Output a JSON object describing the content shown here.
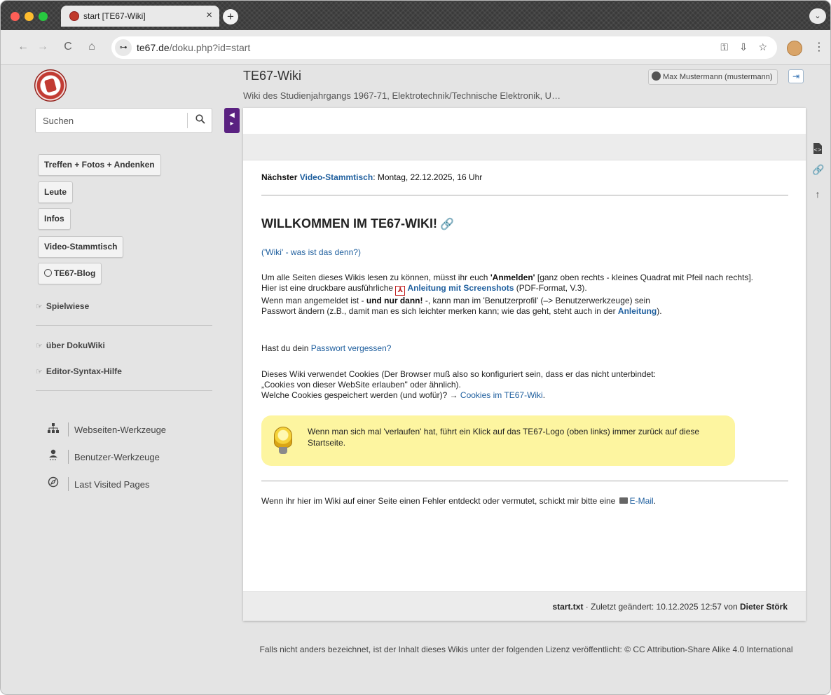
{
  "browser": {
    "tab_title": "start [TE67-Wiki]",
    "tab_close": "×",
    "new_tab": "+",
    "tab_menu": "⌄",
    "back": "←",
    "forward": "→",
    "reload": "C",
    "home": "⌂",
    "site_info": "⊶",
    "url_host": "te67.de",
    "url_path": "/doku.php?id=start",
    "key_icon": "⚿",
    "install_icon": "⇩",
    "star_icon": "☆",
    "menu": "⋮"
  },
  "header": {
    "site_title": "TE67-Wiki",
    "tagline": "Wiki des Studienjahrgangs 1967-71, Elektrotechnik/Technische Elektronik, U…",
    "user": "Max Mustermann (mustermann)",
    "logout_icon": "⇥"
  },
  "sidebar": {
    "search_placeholder": "Suchen",
    "search_icon": "🔍",
    "toggle_icon": "⇦",
    "nav_buttons": [
      "Treffen + Fotos + Andenken",
      "Leute",
      "Infos",
      "Video-Stammtisch",
      "TE67-Blog"
    ],
    "links": [
      "Spielwiese",
      "über DokuWiki",
      "Editor-Syntax-Hilfe"
    ],
    "hand": "☞",
    "tools": [
      "Webseiten-Werkzeuge",
      "Benutzer-Werkzeuge",
      "Last Visited Pages"
    ]
  },
  "content": {
    "next_label": "Nächster",
    "next_link": "Video-Stammtisch",
    "next_rest": ": Montag, 22.12.2025, 16 Uhr",
    "heading": "WILLKOMMEN IM TE67-WIKI!",
    "anchor_icon": "🔗",
    "wiki_link": "('Wiki' - was ist das denn?)",
    "p1_a": "Um alle Seiten dieses Wikis lesen zu können, müsst ihr euch ",
    "p1_b": "'Anmelden'",
    "p1_c": " [ganz oben rechts - kleines Quadrat mit Pfeil nach rechts].",
    "p2_a": "Hier ist eine druckbare ausführliche ",
    "p2_link": "Anleitung mit Screenshots",
    "p2_b": " (PDF-Format, V.3).",
    "p3_a": "Wenn man angemeldet ist - ",
    "p3_b": "und nur dann!",
    "p3_c": " -, kann man im 'Benutzerprofil' (–> Benutzerwerkzeuge) sein",
    "p4_a": "Passwort ändern (z.B., damit man es sich leichter merken kann; wie das geht, steht auch in der ",
    "p4_link": "Anleitung",
    "p4_b": ").",
    "pw_a": "Hast du dein ",
    "pw_link": "Passwort vergessen?",
    "cookie1": "Dieses Wiki verwendet Cookies (Der Browser muß also so konfiguriert sein, dass er das nicht unterbindet:",
    "cookie2": "„Cookies von dieser WebSite erlauben\" oder ähnlich).",
    "cookie3_a": "Welche Cookies gespeichert werden (und wofür)? → ",
    "cookie3_link": "Cookies im TE67-Wiki",
    "cookie3_b": ".",
    "tip": "Wenn man sich mal 'verlaufen' hat, führt ein Klick auf das TE67-Logo (oben links) immer zurück auf diese Startseite.",
    "mail_a": "Wenn ihr hier im Wiki auf einer Seite einen Fehler entdeckt oder vermutet, schickt mir bitte eine ",
    "mail_link": "E-Mail",
    "mail_b": ".",
    "footer_file": "start.txt",
    "footer_mid": " · Zuletzt geändert: 10.12.2025 12:57 von ",
    "footer_author": "Dieter Störk"
  },
  "page_tools": [
    "‹›",
    "🔗",
    "↑"
  ],
  "license": "Falls nicht anders bezeichnet, ist der Inhalt dieses Wikis unter der folgenden Lizenz veröffentlicht: © CC Attribution-Share Alike 4.0 International"
}
